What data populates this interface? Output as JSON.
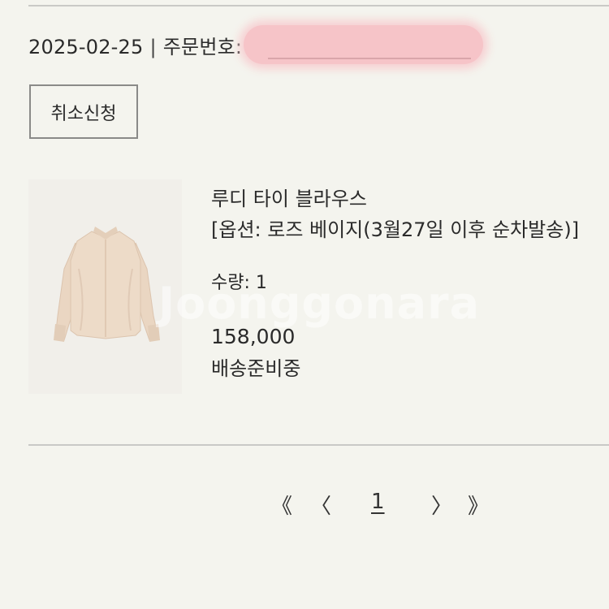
{
  "order": {
    "date": "2025-02-25",
    "separator": "|",
    "order_number_label": "주문번호:"
  },
  "actions": {
    "cancel_label": "취소신청"
  },
  "item": {
    "name": "루디 타이 블라우스",
    "option": "[옵션: 로즈 베이지(3월27일 이후 순차발송)]",
    "quantity": "수량: 1",
    "price": "158,000",
    "status": "배송준비중"
  },
  "watermark": "Joonggonara",
  "pagination": {
    "first": "《",
    "prev": "〈",
    "current": "1",
    "next": "〉",
    "last": "》"
  },
  "colors": {
    "background": "#f4f4ee",
    "redaction": "#f7c2c6",
    "blouse": "#ecd9c6"
  }
}
